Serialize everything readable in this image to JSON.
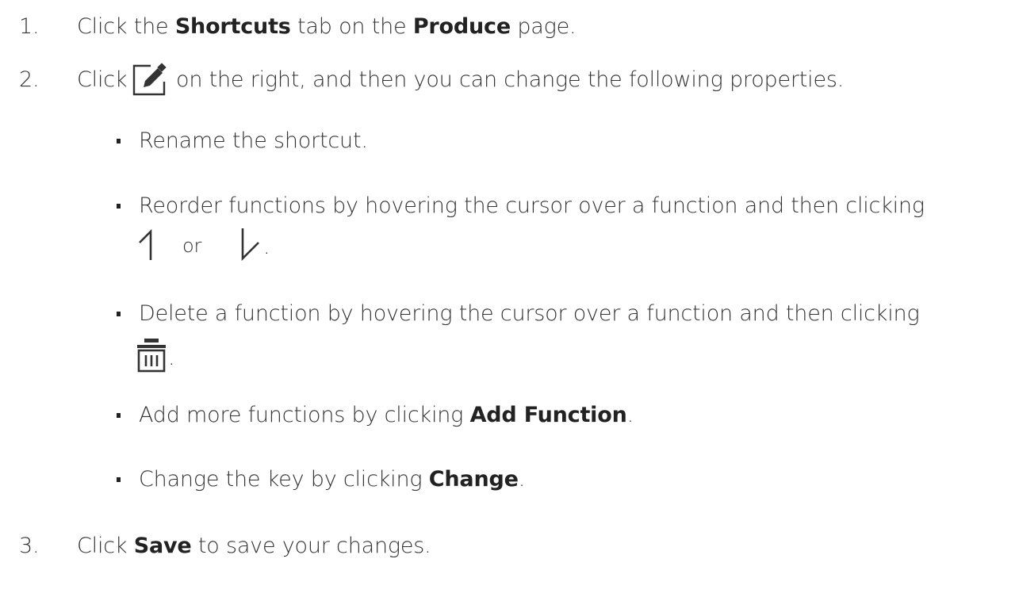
{
  "steps": [
    {
      "number": "1.",
      "pre": "Click the ",
      "b1": "Shortcuts",
      "mid": " tab on the ",
      "b2": "Produce",
      "post": " page."
    },
    {
      "number": "2.",
      "pre": "Click ",
      "post": " on the right, and then you can change the following properties.",
      "icon": "edit-icon"
    },
    {
      "number": "3.",
      "pre": "Click ",
      "b1": "Save",
      "post": " to save your changes."
    }
  ],
  "bullets": {
    "rename": {
      "text": "Rename the shortcut."
    },
    "reorder": {
      "line1": "Reorder functions by hovering the cursor over a function and then clicking",
      "or": "or",
      "period": ".",
      "icons": [
        "arrow-up-icon",
        "arrow-down-icon"
      ]
    },
    "delete": {
      "line1": "Delete a function by hovering the cursor over a function and then clicking",
      "period": ".",
      "icon": "trash-icon"
    },
    "add": {
      "pre": "Add more functions by clicking ",
      "b": "Add Function",
      "post": "."
    },
    "change": {
      "pre": "Change the key by clicking ",
      "b": "Change",
      "post": "."
    }
  },
  "colors": {
    "text": "#333333",
    "bold": "#222222",
    "icon": "#333333"
  }
}
